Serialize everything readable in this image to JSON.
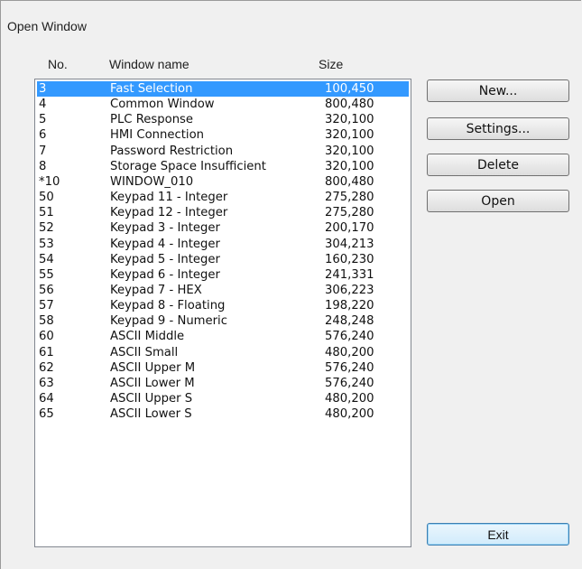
{
  "window": {
    "title": "Open Window"
  },
  "list": {
    "headers": {
      "no": "No.",
      "name": "Window name",
      "size": "Size"
    },
    "rows": [
      {
        "no": "3",
        "name": "Fast Selection",
        "size": "100,450",
        "selected": true
      },
      {
        "no": "4",
        "name": "Common Window",
        "size": "800,480"
      },
      {
        "no": "5",
        "name": "PLC Response",
        "size": "320,100"
      },
      {
        "no": "6",
        "name": "HMI Connection",
        "size": "320,100"
      },
      {
        "no": "7",
        "name": "Password Restriction",
        "size": "320,100"
      },
      {
        "no": "8",
        "name": "Storage Space Insufficient",
        "size": "320,100"
      },
      {
        "no": "*10",
        "name": "WINDOW_010",
        "size": "800,480"
      },
      {
        "no": "50",
        "name": "Keypad 11 - Integer",
        "size": "275,280"
      },
      {
        "no": "51",
        "name": "Keypad 12 - Integer",
        "size": "275,280"
      },
      {
        "no": "52",
        "name": "Keypad 3 - Integer",
        "size": "200,170"
      },
      {
        "no": "53",
        "name": "Keypad 4 - Integer",
        "size": "304,213"
      },
      {
        "no": "54",
        "name": "Keypad 5 - Integer",
        "size": "160,230"
      },
      {
        "no": "55",
        "name": "Keypad 6 - Integer",
        "size": "241,331"
      },
      {
        "no": "56",
        "name": "Keypad 7 - HEX",
        "size": "306,223"
      },
      {
        "no": "57",
        "name": "Keypad 8 - Floating",
        "size": "198,220"
      },
      {
        "no": "58",
        "name": "Keypad 9 - Numeric",
        "size": "248,248"
      },
      {
        "no": "60",
        "name": "ASCII Middle",
        "size": "576,240"
      },
      {
        "no": "61",
        "name": "ASCII Small",
        "size": "480,200"
      },
      {
        "no": "62",
        "name": "ASCII Upper M",
        "size": "576,240"
      },
      {
        "no": "63",
        "name": "ASCII Lower M",
        "size": "576,240"
      },
      {
        "no": "64",
        "name": "ASCII Upper S",
        "size": "480,200"
      },
      {
        "no": "65",
        "name": "ASCII Lower S",
        "size": "480,200"
      }
    ]
  },
  "buttons": {
    "new": "New...",
    "settings": "Settings...",
    "delete": "Delete",
    "open": "Open",
    "exit": "Exit"
  },
  "colors": {
    "selection": "#3399ff",
    "selection_text": "#ffffff"
  }
}
